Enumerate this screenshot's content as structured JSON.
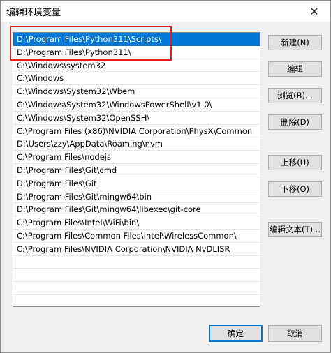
{
  "window": {
    "title": "编辑环境变量",
    "close_label": "✕"
  },
  "list": {
    "items": [
      "D:\\Program Files\\Python311\\Scripts\\",
      "D:\\Program Files\\Python311\\",
      "C:\\Windows\\system32",
      "C:\\Windows",
      "C:\\Windows\\System32\\Wbem",
      "C:\\Windows\\System32\\WindowsPowerShell\\v1.0\\",
      "C:\\Windows\\System32\\OpenSSH\\",
      "C:\\Program Files (x86)\\NVIDIA Corporation\\PhysX\\Common",
      "D:\\Users\\zzy\\AppData\\Roaming\\nvm",
      "C:\\Program Files\\nodejs",
      "D:\\Program Files\\Git\\cmd",
      "D:\\Program Files\\Git",
      "D:\\Program Files\\Git\\mingw64\\bin",
      "D:\\Program Files\\Git\\mingw64\\libexec\\git-core",
      "C:\\Program Files\\Intel\\WiFi\\bin\\",
      "C:\\Program Files\\Common Files\\Intel\\WirelessCommon\\",
      "C:\\Program Files\\NVIDIA Corporation\\NVIDIA NvDLISR"
    ],
    "selected_index": 0
  },
  "buttons": {
    "new": "新建(N)",
    "edit": "编辑",
    "browse": "浏览(B)...",
    "delete": "删除(D)",
    "move_up": "上移(U)",
    "move_down": "下移(O)",
    "edit_text": "编辑文本(T)...",
    "ok": "确定",
    "cancel": "取消"
  }
}
